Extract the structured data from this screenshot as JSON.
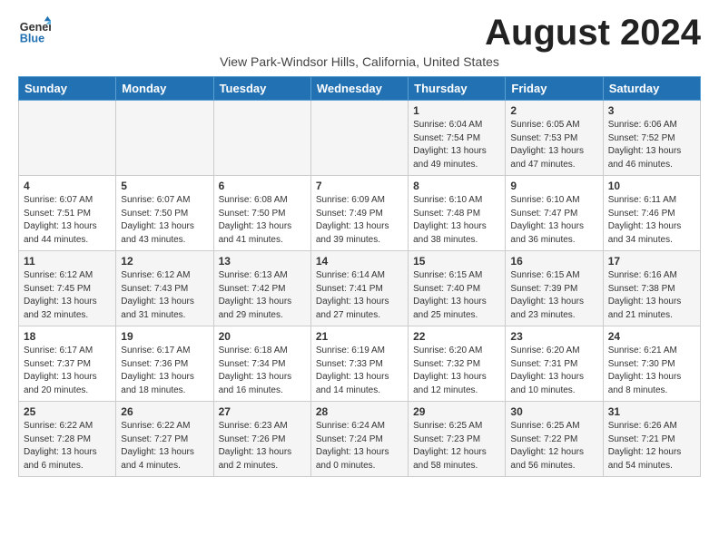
{
  "logo": {
    "text_general": "General",
    "text_blue": "Blue"
  },
  "month_title": "August 2024",
  "subtitle": "View Park-Windsor Hills, California, United States",
  "days_of_week": [
    "Sunday",
    "Monday",
    "Tuesday",
    "Wednesday",
    "Thursday",
    "Friday",
    "Saturday"
  ],
  "weeks": [
    [
      {
        "day": "",
        "info": ""
      },
      {
        "day": "",
        "info": ""
      },
      {
        "day": "",
        "info": ""
      },
      {
        "day": "",
        "info": ""
      },
      {
        "day": "1",
        "info": "Sunrise: 6:04 AM\nSunset: 7:54 PM\nDaylight: 13 hours\nand 49 minutes."
      },
      {
        "day": "2",
        "info": "Sunrise: 6:05 AM\nSunset: 7:53 PM\nDaylight: 13 hours\nand 47 minutes."
      },
      {
        "day": "3",
        "info": "Sunrise: 6:06 AM\nSunset: 7:52 PM\nDaylight: 13 hours\nand 46 minutes."
      }
    ],
    [
      {
        "day": "4",
        "info": "Sunrise: 6:07 AM\nSunset: 7:51 PM\nDaylight: 13 hours\nand 44 minutes."
      },
      {
        "day": "5",
        "info": "Sunrise: 6:07 AM\nSunset: 7:50 PM\nDaylight: 13 hours\nand 43 minutes."
      },
      {
        "day": "6",
        "info": "Sunrise: 6:08 AM\nSunset: 7:50 PM\nDaylight: 13 hours\nand 41 minutes."
      },
      {
        "day": "7",
        "info": "Sunrise: 6:09 AM\nSunset: 7:49 PM\nDaylight: 13 hours\nand 39 minutes."
      },
      {
        "day": "8",
        "info": "Sunrise: 6:10 AM\nSunset: 7:48 PM\nDaylight: 13 hours\nand 38 minutes."
      },
      {
        "day": "9",
        "info": "Sunrise: 6:10 AM\nSunset: 7:47 PM\nDaylight: 13 hours\nand 36 minutes."
      },
      {
        "day": "10",
        "info": "Sunrise: 6:11 AM\nSunset: 7:46 PM\nDaylight: 13 hours\nand 34 minutes."
      }
    ],
    [
      {
        "day": "11",
        "info": "Sunrise: 6:12 AM\nSunset: 7:45 PM\nDaylight: 13 hours\nand 32 minutes."
      },
      {
        "day": "12",
        "info": "Sunrise: 6:12 AM\nSunset: 7:43 PM\nDaylight: 13 hours\nand 31 minutes."
      },
      {
        "day": "13",
        "info": "Sunrise: 6:13 AM\nSunset: 7:42 PM\nDaylight: 13 hours\nand 29 minutes."
      },
      {
        "day": "14",
        "info": "Sunrise: 6:14 AM\nSunset: 7:41 PM\nDaylight: 13 hours\nand 27 minutes."
      },
      {
        "day": "15",
        "info": "Sunrise: 6:15 AM\nSunset: 7:40 PM\nDaylight: 13 hours\nand 25 minutes."
      },
      {
        "day": "16",
        "info": "Sunrise: 6:15 AM\nSunset: 7:39 PM\nDaylight: 13 hours\nand 23 minutes."
      },
      {
        "day": "17",
        "info": "Sunrise: 6:16 AM\nSunset: 7:38 PM\nDaylight: 13 hours\nand 21 minutes."
      }
    ],
    [
      {
        "day": "18",
        "info": "Sunrise: 6:17 AM\nSunset: 7:37 PM\nDaylight: 13 hours\nand 20 minutes."
      },
      {
        "day": "19",
        "info": "Sunrise: 6:17 AM\nSunset: 7:36 PM\nDaylight: 13 hours\nand 18 minutes."
      },
      {
        "day": "20",
        "info": "Sunrise: 6:18 AM\nSunset: 7:34 PM\nDaylight: 13 hours\nand 16 minutes."
      },
      {
        "day": "21",
        "info": "Sunrise: 6:19 AM\nSunset: 7:33 PM\nDaylight: 13 hours\nand 14 minutes."
      },
      {
        "day": "22",
        "info": "Sunrise: 6:20 AM\nSunset: 7:32 PM\nDaylight: 13 hours\nand 12 minutes."
      },
      {
        "day": "23",
        "info": "Sunrise: 6:20 AM\nSunset: 7:31 PM\nDaylight: 13 hours\nand 10 minutes."
      },
      {
        "day": "24",
        "info": "Sunrise: 6:21 AM\nSunset: 7:30 PM\nDaylight: 13 hours\nand 8 minutes."
      }
    ],
    [
      {
        "day": "25",
        "info": "Sunrise: 6:22 AM\nSunset: 7:28 PM\nDaylight: 13 hours\nand 6 minutes."
      },
      {
        "day": "26",
        "info": "Sunrise: 6:22 AM\nSunset: 7:27 PM\nDaylight: 13 hours\nand 4 minutes."
      },
      {
        "day": "27",
        "info": "Sunrise: 6:23 AM\nSunset: 7:26 PM\nDaylight: 13 hours\nand 2 minutes."
      },
      {
        "day": "28",
        "info": "Sunrise: 6:24 AM\nSunset: 7:24 PM\nDaylight: 13 hours\nand 0 minutes."
      },
      {
        "day": "29",
        "info": "Sunrise: 6:25 AM\nSunset: 7:23 PM\nDaylight: 12 hours\nand 58 minutes."
      },
      {
        "day": "30",
        "info": "Sunrise: 6:25 AM\nSunset: 7:22 PM\nDaylight: 12 hours\nand 56 minutes."
      },
      {
        "day": "31",
        "info": "Sunrise: 6:26 AM\nSunset: 7:21 PM\nDaylight: 12 hours\nand 54 minutes."
      }
    ]
  ]
}
